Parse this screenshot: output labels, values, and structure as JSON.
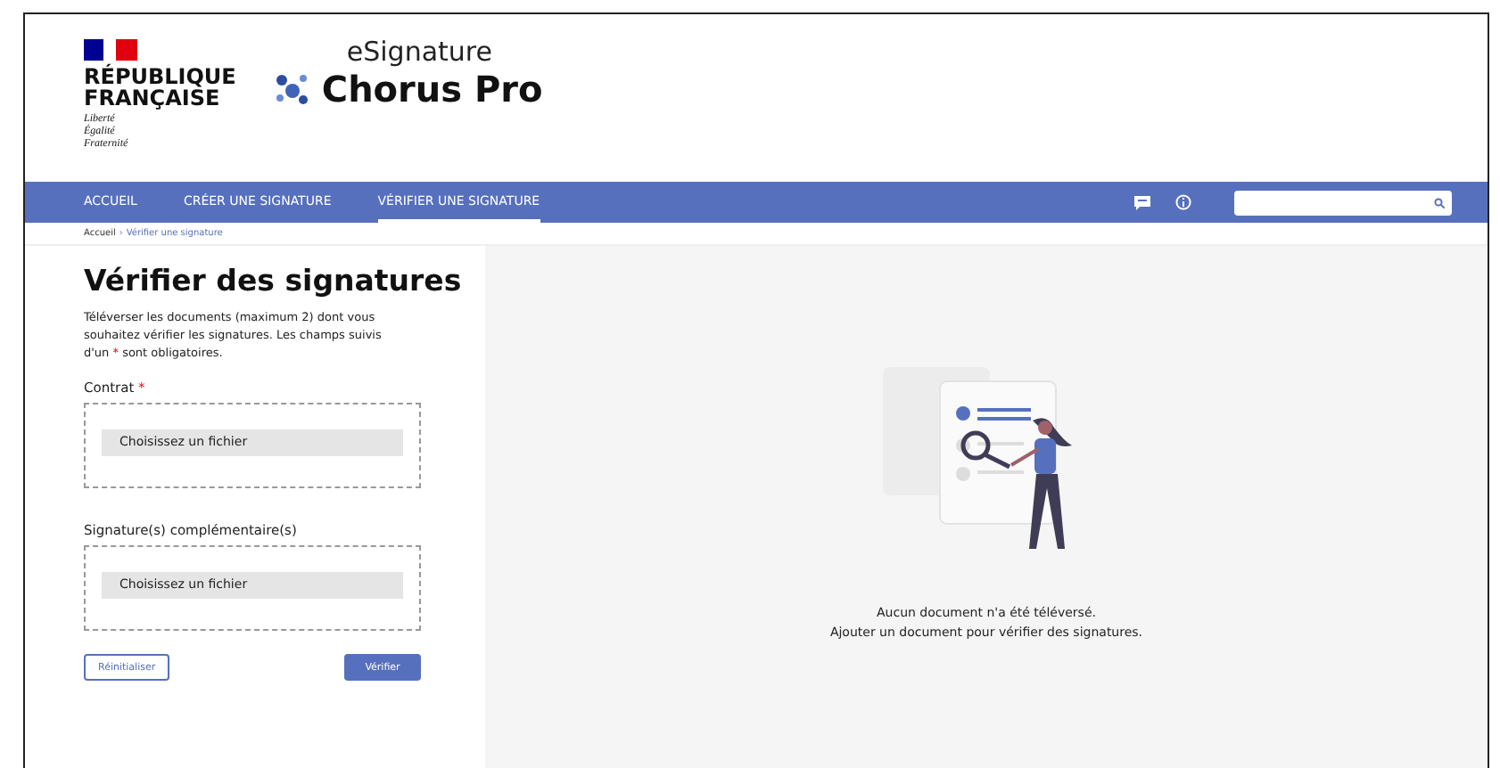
{
  "brand": {
    "flag_lines": [
      "RÉPUBLIQUE",
      "FRANÇAISE"
    ],
    "motto": [
      "Liberté",
      "Égalité",
      "Fraternité"
    ],
    "service_kicker": "eSignature",
    "service_name": "Chorus Pro"
  },
  "nav": {
    "items": [
      {
        "label": "ACCUEIL",
        "selected": false
      },
      {
        "label": "CRÉER UNE SIGNATURE",
        "selected": false
      },
      {
        "label": "VÉRIFIER UNE SIGNATURE",
        "selected": true
      }
    ]
  },
  "breadcrumb": {
    "items": [
      "Accueil",
      "Vérifier une signature"
    ],
    "separator": "›"
  },
  "form": {
    "title": "Vérifier des signatures",
    "description": {
      "before": "Téléverser les documents (maximum 2) dont vous souhaitez vérifier les signatures. Les champs suivis d'un",
      "mark": "*",
      "after": "sont obligatoires."
    },
    "fields": [
      {
        "label": "Contrat",
        "required": true,
        "button": "Choisissez un fichier"
      },
      {
        "label": "Signature(s) complémentaire(s)",
        "required": false,
        "button": "Choisissez un fichier"
      }
    ],
    "reset_button": "Réinitialiser",
    "submit_button": "Vérifier"
  },
  "empty_state": {
    "lines": [
      "Aucun document n'a été téléversé.",
      "Ajouter un document pour vérifier des signatures."
    ]
  }
}
